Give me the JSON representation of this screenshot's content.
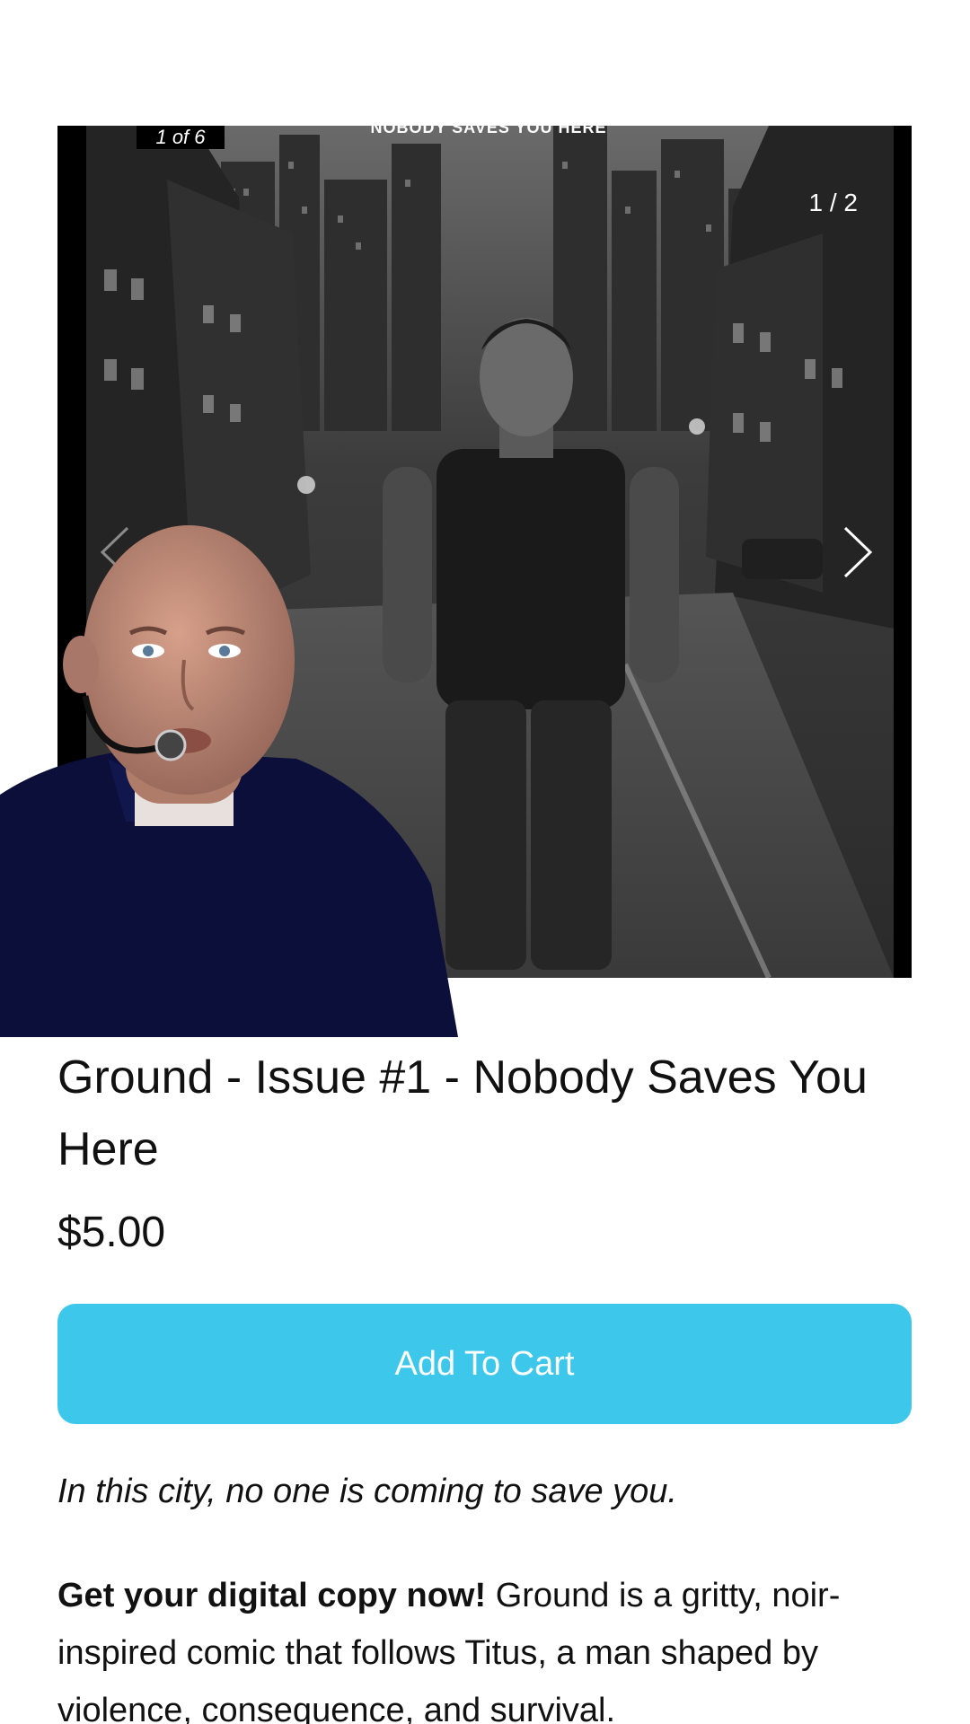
{
  "gallery": {
    "slide_badge": "1 of 6",
    "cover_title_strip": "NOBODY SAVES YOU HERE",
    "page_count": "1 / 2",
    "next_icon": "chevron-right-icon",
    "prev_icon": "chevron-left-icon"
  },
  "product": {
    "title": "Ground - Issue #1 - Nobody Saves You Here",
    "price": "$5.00",
    "add_to_cart_label": "Add To Cart",
    "add_to_cart_color": "#3dc7ea",
    "tagline": "In this city, no one is coming to save you.",
    "description_bold": "Get your digital copy now!",
    "description_text": " Ground is a gritty, noir-inspired comic that follows Titus, a man shaped by violence, consequence, and survival."
  }
}
